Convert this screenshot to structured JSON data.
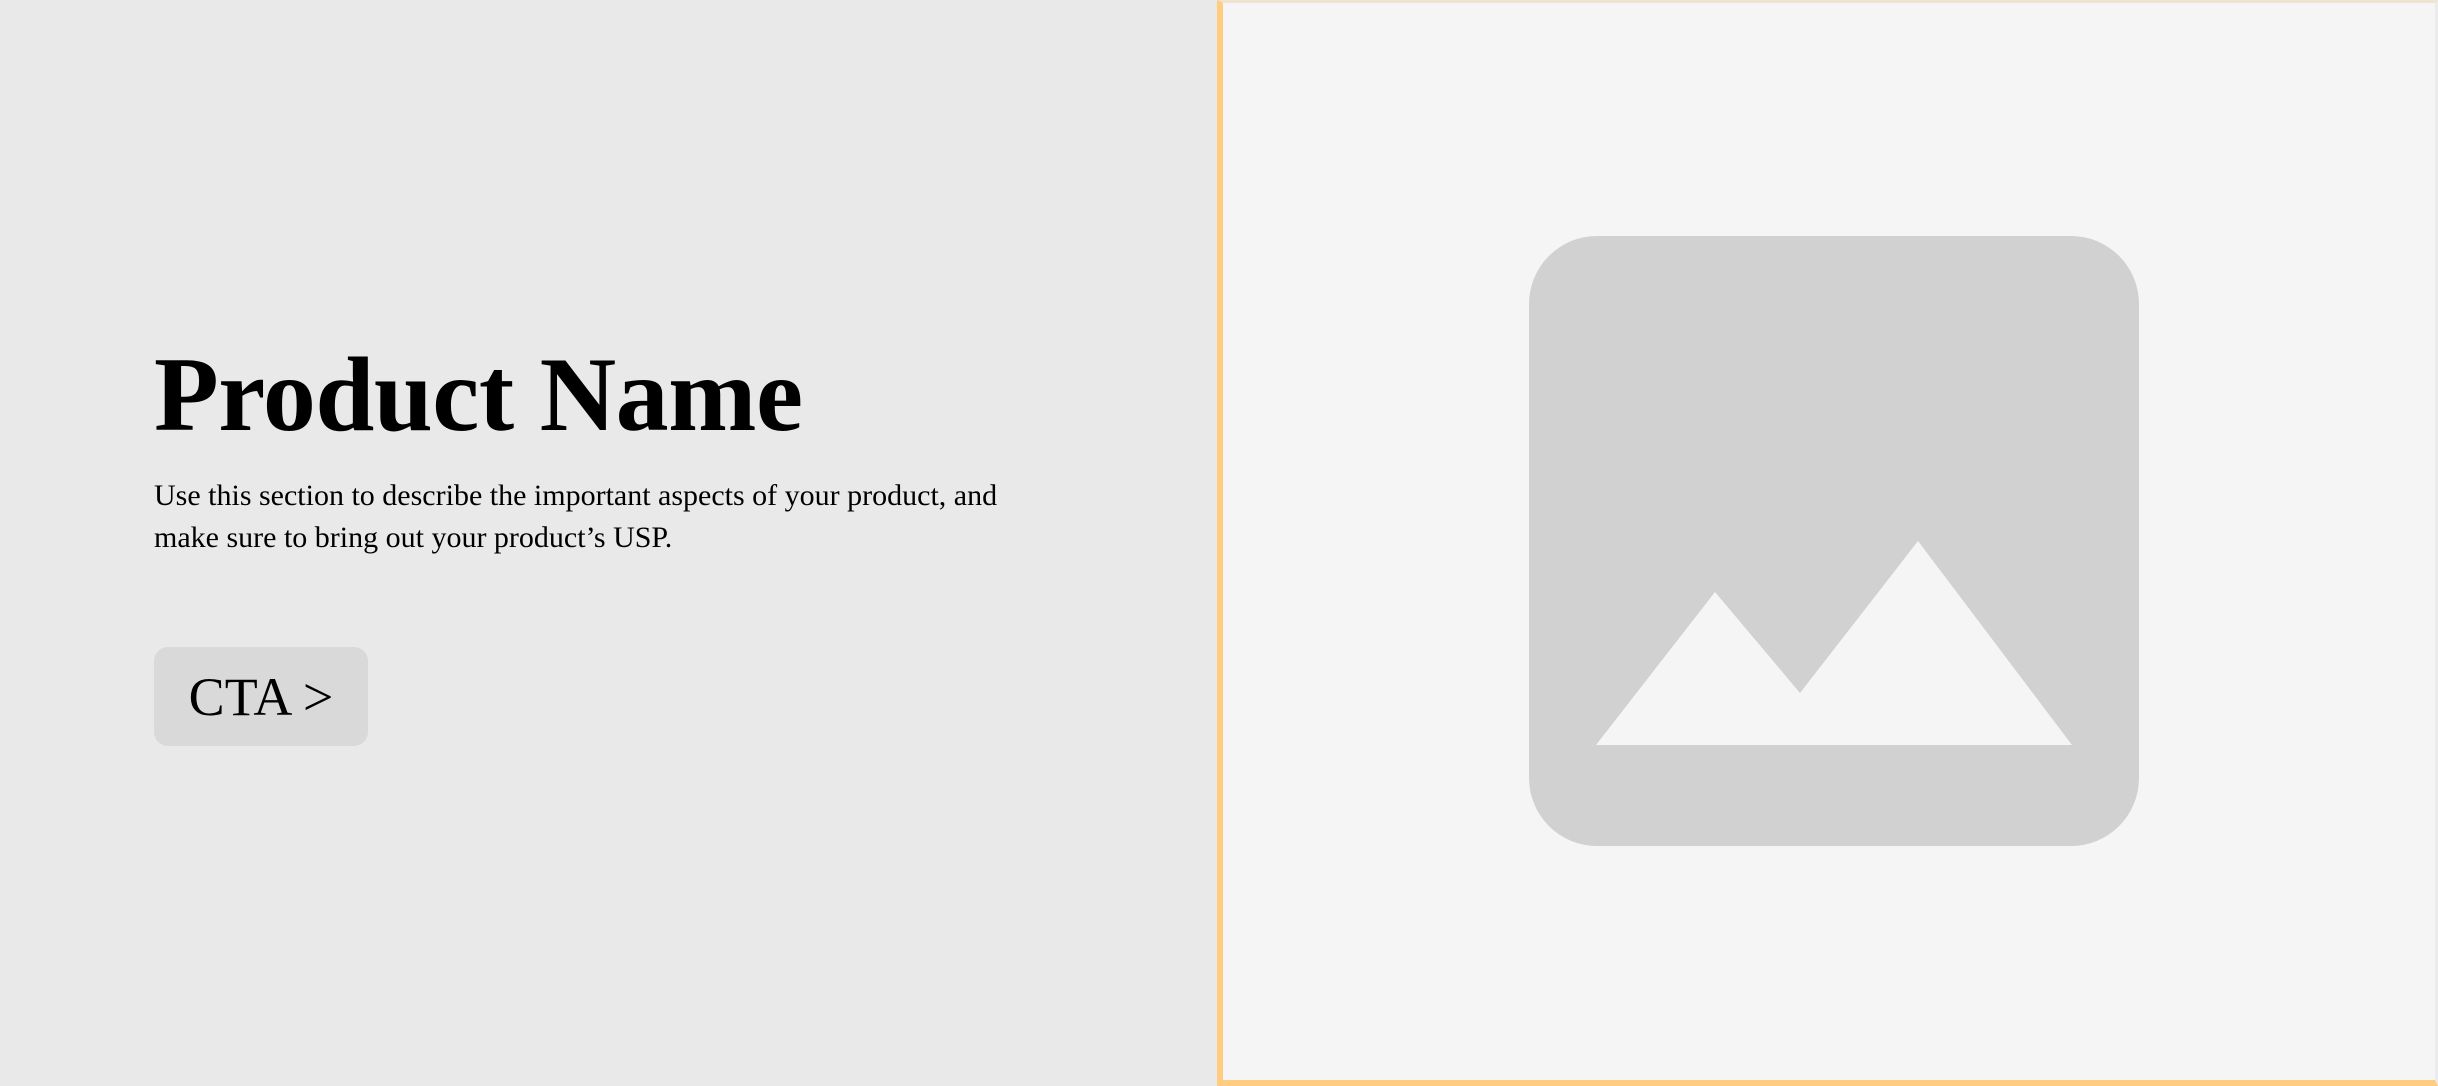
{
  "hero": {
    "title": "Product Name",
    "description": "Use this section to describe the important aspects of your product, and make sure to bring out your product’s USP.",
    "cta_label": "CTA >"
  },
  "image": {
    "icon": "image-placeholder-icon"
  },
  "colors": {
    "left_background": "#e9e9e9",
    "right_background": "#f5f5f5",
    "button_background": "#d9d9d9",
    "selection_border": "#ffcc80",
    "placeholder_fill": "#d1d1d1"
  }
}
